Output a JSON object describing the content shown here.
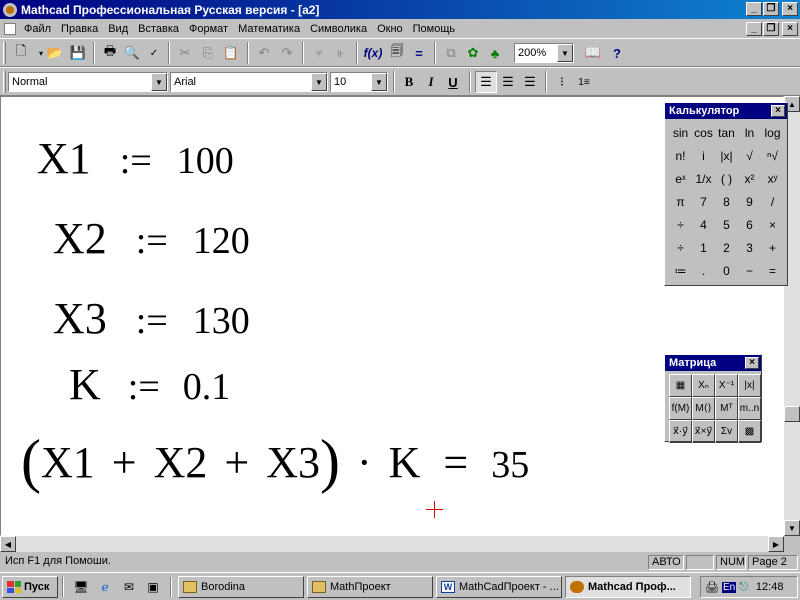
{
  "window": {
    "title": "Mathcad Профессиональная Русская версия - [a2]"
  },
  "menu": {
    "items": [
      "Файл",
      "Правка",
      "Вид",
      "Вставка",
      "Формат",
      "Математика",
      "Символика",
      "Окно",
      "Помощь"
    ]
  },
  "toolbar": {
    "zoom": "200%"
  },
  "format_bar": {
    "style": "Normal",
    "font": "Arial",
    "size": "10",
    "bold": "B",
    "italic": "I",
    "underline": "U"
  },
  "worksheet": {
    "assign_op": ":=",
    "expressions": [
      {
        "var": "X1",
        "value": "100"
      },
      {
        "var": "X2",
        "value": "120"
      },
      {
        "var": "X3",
        "value": "130"
      },
      {
        "var": "K",
        "value": "0.1"
      }
    ],
    "result": {
      "lhs_open": "(",
      "term1": "X1",
      "plus1": "+",
      "term2": "X2",
      "plus2": "+",
      "term3": "X3",
      "lhs_close": ")",
      "dot": "·",
      "factor": "K",
      "eq": "=",
      "value": "35"
    }
  },
  "calculator_palette": {
    "title": "Калькулятор",
    "keys": [
      "sin",
      "cos",
      "tan",
      "ln",
      "log",
      "n!",
      "i",
      "|x|",
      "√",
      "ⁿ√",
      "eˣ",
      "1/x",
      "( )",
      "x²",
      "xʸ",
      "π",
      "7",
      "8",
      "9",
      "/",
      "÷",
      "4",
      "5",
      "6",
      "×",
      "÷",
      "1",
      "2",
      "3",
      "+",
      "≔",
      ".",
      "0",
      "−",
      "="
    ]
  },
  "matrix_palette": {
    "title": "Матрица",
    "keys": [
      "▦",
      "Xₙ",
      "X⁻¹",
      "|x|",
      "f(M)",
      "M⟨⟩",
      "Mᵀ",
      "m..n",
      "x⃗·y⃗",
      "x⃗×y⃗",
      "Σv",
      "▩"
    ]
  },
  "statusbar": {
    "help_text": "Исп F1 для Помоши.",
    "mode": "АВТО",
    "num": "NUM",
    "page": "Page 2"
  },
  "taskbar": {
    "start": "Пуск",
    "tasks": [
      "Borodina",
      "MathПроект",
      "MathCadПроект - ...",
      "Mathcad Проф..."
    ],
    "lang": "En",
    "clock": "12:48"
  }
}
